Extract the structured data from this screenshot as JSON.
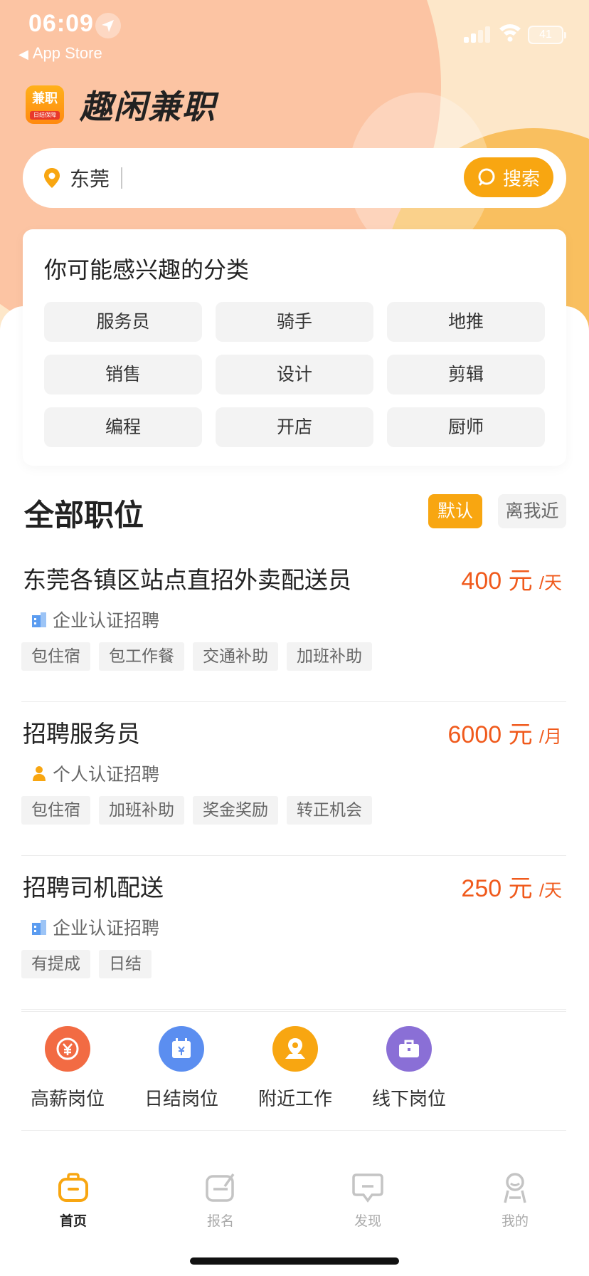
{
  "status": {
    "time": "06:09",
    "back_label": "App Store",
    "battery": "41"
  },
  "app": {
    "logo_text": "兼职",
    "logo_sub": "日结保障",
    "name": "趣闲兼职"
  },
  "search": {
    "city": "东莞",
    "button_label": "搜索"
  },
  "categories": {
    "title": "你可能感兴趣的分类",
    "items": [
      "服务员",
      "骑手",
      "地推",
      "销售",
      "设计",
      "剪辑",
      "编程",
      "开店",
      "厨师"
    ]
  },
  "jobs_section": {
    "title": "全部职位",
    "sort_default": "默认",
    "sort_near": "离我近"
  },
  "jobs": [
    {
      "title": "东莞各镇区站点直招外卖配送员",
      "amount": "400",
      "currency": "元",
      "unit": "/天",
      "verify": "企业认证招聘",
      "verify_icon": "building-icon",
      "tags": [
        "包住宿",
        "包工作餐",
        "交通补助",
        "加班补助"
      ]
    },
    {
      "title": "招聘服务员",
      "amount": "6000",
      "currency": "元",
      "unit": "/月",
      "verify": "个人认证招聘",
      "verify_icon": "person-icon",
      "tags": [
        "包住宿",
        "加班补助",
        "奖金奖励",
        "转正机会"
      ]
    },
    {
      "title": "招聘司机配送",
      "amount": "250",
      "currency": "元",
      "unit": "/天",
      "verify": "企业认证招聘",
      "verify_icon": "building-icon",
      "tags": [
        "有提成",
        "日结"
      ]
    }
  ],
  "quick_links": [
    {
      "label": "高薪岗位",
      "icon": "yen-coin-icon",
      "color": "#f26b43"
    },
    {
      "label": "日结岗位",
      "icon": "calendar-yen-icon",
      "color": "#5b8ef0"
    },
    {
      "label": "附近工作",
      "icon": "map-pin-icon",
      "color": "#f8a611"
    },
    {
      "label": "线下岗位",
      "icon": "briefcase-icon",
      "color": "#8a6fd6"
    }
  ],
  "tabs": [
    {
      "label": "首页",
      "icon": "home-bag-icon",
      "active": true
    },
    {
      "label": "报名",
      "icon": "signup-icon",
      "active": false
    },
    {
      "label": "发现",
      "icon": "discover-chat-icon",
      "active": false
    },
    {
      "label": "我的",
      "icon": "profile-icon",
      "active": false
    }
  ],
  "colors": {
    "accent": "#f8a611",
    "salary": "#f05a1c",
    "chip_bg": "#f3f3f3"
  }
}
